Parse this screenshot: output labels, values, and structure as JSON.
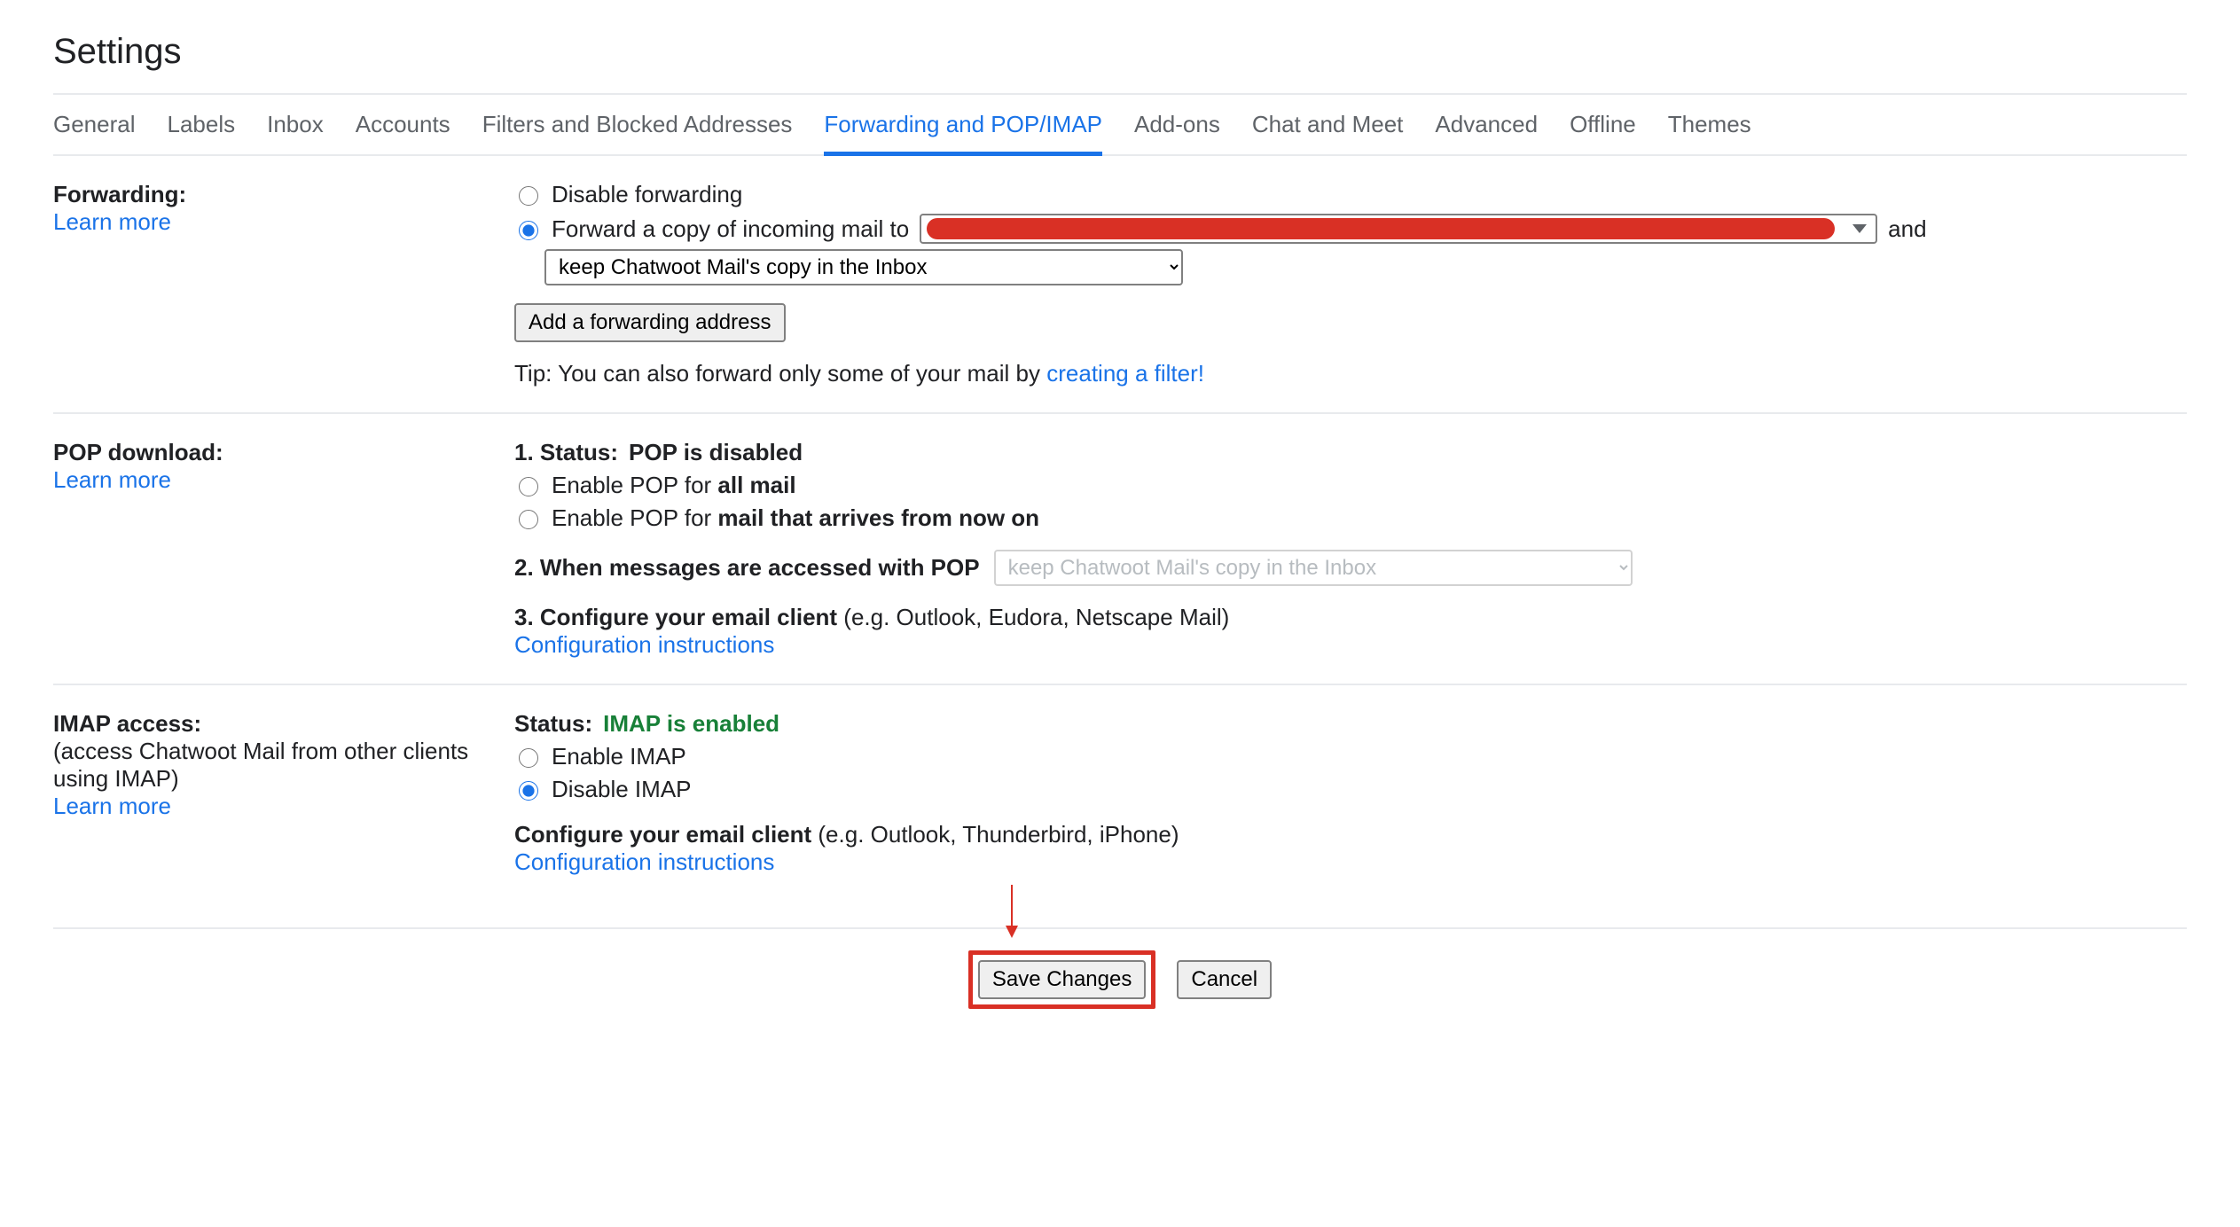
{
  "page": {
    "title": "Settings"
  },
  "tabs": [
    {
      "label": "General"
    },
    {
      "label": "Labels"
    },
    {
      "label": "Inbox"
    },
    {
      "label": "Accounts"
    },
    {
      "label": "Filters and Blocked Addresses"
    },
    {
      "label": "Forwarding and POP/IMAP"
    },
    {
      "label": "Add-ons"
    },
    {
      "label": "Chat and Meet"
    },
    {
      "label": "Advanced"
    },
    {
      "label": "Offline"
    },
    {
      "label": "Themes"
    }
  ],
  "forwarding": {
    "heading": "Forwarding:",
    "learn_more": "Learn more",
    "disable_label": "Disable forwarding",
    "forward_label": "Forward a copy of incoming mail to",
    "and_text": "and",
    "action_selected": "keep Chatwoot Mail's copy in the Inbox",
    "add_button": "Add a forwarding address",
    "tip_prefix": "Tip: You can also forward only some of your mail by ",
    "tip_link": "creating a filter!"
  },
  "pop": {
    "heading": "POP download:",
    "learn_more": "Learn more",
    "status_prefix": "1. Status: ",
    "status_value": "POP is disabled",
    "enable_all_pre": "Enable POP for ",
    "enable_all_bold": "all mail",
    "enable_now_pre": "Enable POP for ",
    "enable_now_bold": "mail that arrives from now on",
    "step2": "2. When messages are accessed with POP",
    "step2_selected": "keep Chatwoot Mail's copy in the Inbox",
    "step3_bold": "3. Configure your email client",
    "step3_note": " (e.g. Outlook, Eudora, Netscape Mail)",
    "config_link": "Configuration instructions"
  },
  "imap": {
    "heading": "IMAP access:",
    "sub": "(access Chatwoot Mail from other clients using IMAP)",
    "learn_more": "Learn more",
    "status_prefix": "Status: ",
    "status_value": "IMAP is enabled",
    "enable_label": "Enable IMAP",
    "disable_label": "Disable IMAP",
    "configure_bold": "Configure your email client",
    "configure_note": " (e.g. Outlook, Thunderbird, iPhone)",
    "config_link": "Configuration instructions"
  },
  "footer": {
    "save": "Save Changes",
    "cancel": "Cancel"
  }
}
